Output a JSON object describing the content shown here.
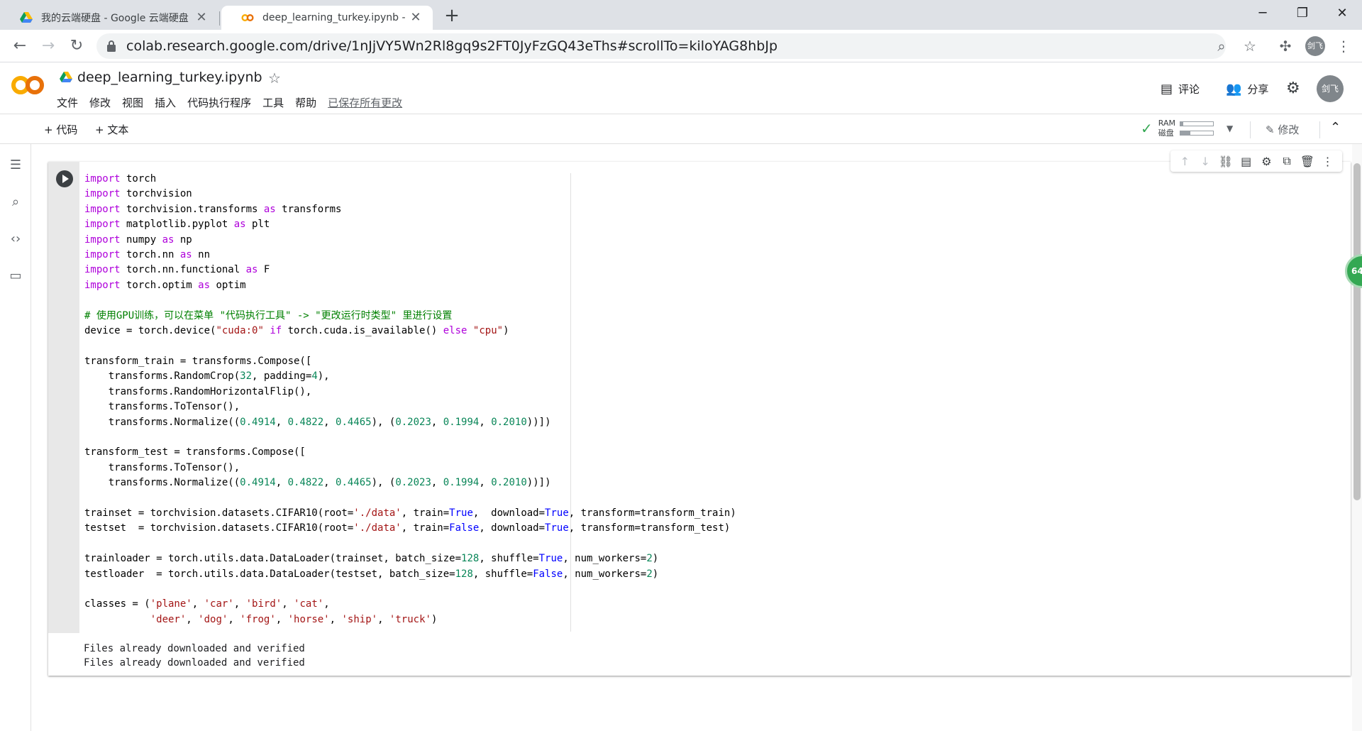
{
  "browser": {
    "tabs": [
      {
        "title": "我的云端硬盘 - Google 云端硬盘",
        "icon": "google-drive-icon",
        "active": false
      },
      {
        "title": "deep_learning_turkey.ipynb - Colaboratory",
        "icon": "colab-icon",
        "active": true
      }
    ],
    "url": "colab.research.google.com/drive/1nJjVY5Wn2Rl8gq9s2FT0JyFzGQ43eThs#scrollTo=kiloYAG8hbJp",
    "profile_initials": "剑飞"
  },
  "header": {
    "notebook_title": "deep_learning_turkey.ipynb",
    "menu": [
      "文件",
      "修改",
      "视图",
      "插入",
      "代码执行程序",
      "工具",
      "帮助"
    ],
    "save_status": "已保存所有更改",
    "comment_label": "评论",
    "share_label": "分享",
    "avatar_initials": "剑飞"
  },
  "cellbar": {
    "add_code": "+ 代码",
    "add_text": "+ 文本",
    "ram_label": "RAM",
    "disk_label": "磁盘",
    "ram_fraction": 0.08,
    "disk_fraction": 0.3,
    "edit_label": "修改"
  },
  "cell": {
    "code_lines": [
      "import torch",
      "import torchvision",
      "import torchvision.transforms as transforms",
      "import matplotlib.pyplot as plt",
      "import numpy as np",
      "import torch.nn as nn",
      "import torch.nn.functional as F",
      "import torch.optim as optim",
      "",
      "# 使用GPU训练，可以在菜单 \"代码执行工具\" -> \"更改运行时类型\" 里进行设置",
      "device = torch.device(\"cuda:0\" if torch.cuda.is_available() else \"cpu\")",
      "",
      "transform_train = transforms.Compose([",
      "    transforms.RandomCrop(32, padding=4),",
      "    transforms.RandomHorizontalFlip(),",
      "    transforms.ToTensor(),",
      "    transforms.Normalize((0.4914, 0.4822, 0.4465), (0.2023, 0.1994, 0.2010))])",
      "",
      "transform_test = transforms.Compose([",
      "    transforms.ToTensor(),",
      "    transforms.Normalize((0.4914, 0.4822, 0.4465), (0.2023, 0.1994, 0.2010))])",
      "",
      "trainset = torchvision.datasets.CIFAR10(root='./data', train=True,  download=True, transform=transform_train)",
      "testset  = torchvision.datasets.CIFAR10(root='./data', train=False, download=True, transform=transform_test)",
      "",
      "trainloader = torch.utils.data.DataLoader(trainset, batch_size=128, shuffle=True, num_workers=2)",
      "testloader  = torch.utils.data.DataLoader(testset, batch_size=128, shuffle=False, num_workers=2)",
      "",
      "classes = ('plane', 'car', 'bird', 'cat',",
      "           'deer', 'dog', 'frog', 'horse', 'ship', 'truck')"
    ],
    "output_lines": [
      "Files already downloaded and verified",
      "Files already downloaded and verified"
    ]
  },
  "floating_badge": "64"
}
